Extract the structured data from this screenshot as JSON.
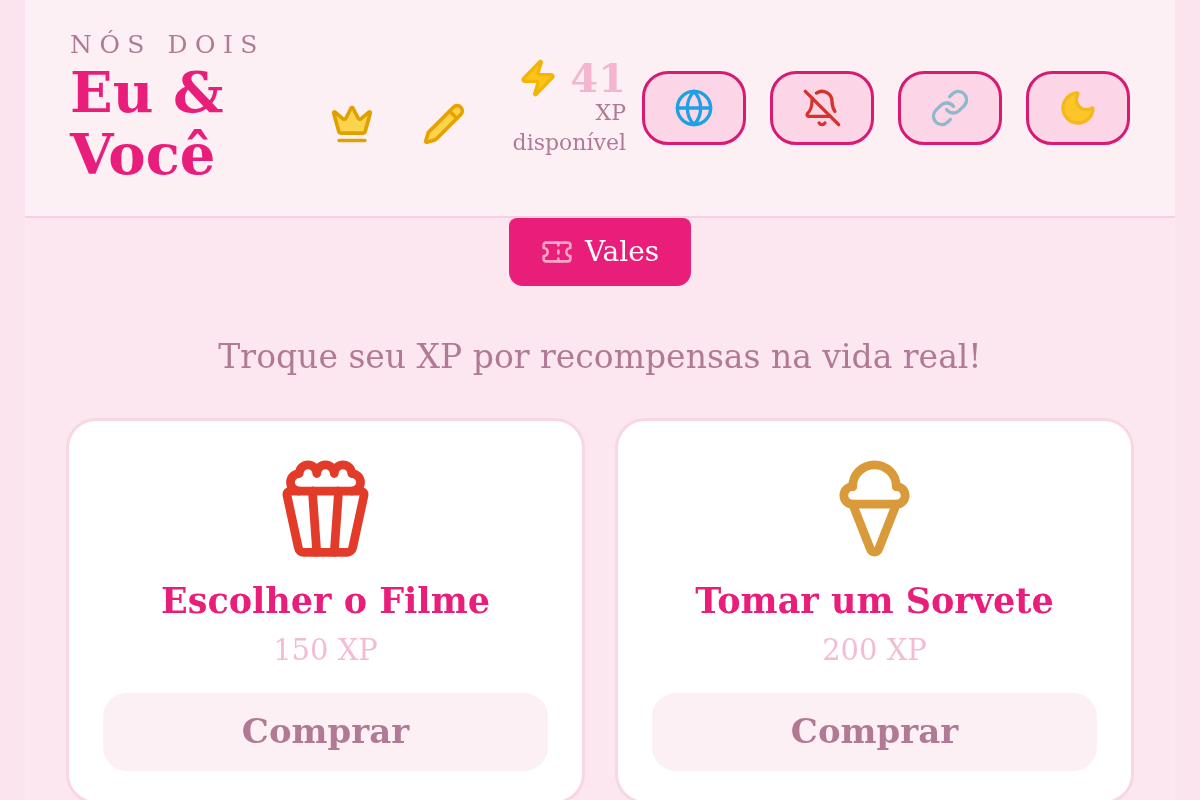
{
  "header": {
    "eyebrow": "NÓS DOIS",
    "title": "Eu & Você",
    "badges": [
      {
        "kind": "crown"
      },
      {
        "kind": "pencil"
      }
    ],
    "xp": {
      "value": "41",
      "label": "XP disponível"
    },
    "buttons": [
      {
        "kind": "globe"
      },
      {
        "kind": "bell-off"
      },
      {
        "kind": "link"
      },
      {
        "kind": "moon"
      }
    ]
  },
  "tabs": [
    {
      "label": "Vales",
      "kind": "ticket",
      "selected": true
    }
  ],
  "subtitle": "Troque seu XP por recompensas na vida real!",
  "rewards": [
    {
      "kind": "popcorn",
      "title": "Escolher o Filme",
      "price": "150 XP",
      "button": "Comprar"
    },
    {
      "kind": "ice-cream",
      "title": "Tomar um Sorvete",
      "price": "200 XP",
      "button": "Comprar"
    }
  ]
}
